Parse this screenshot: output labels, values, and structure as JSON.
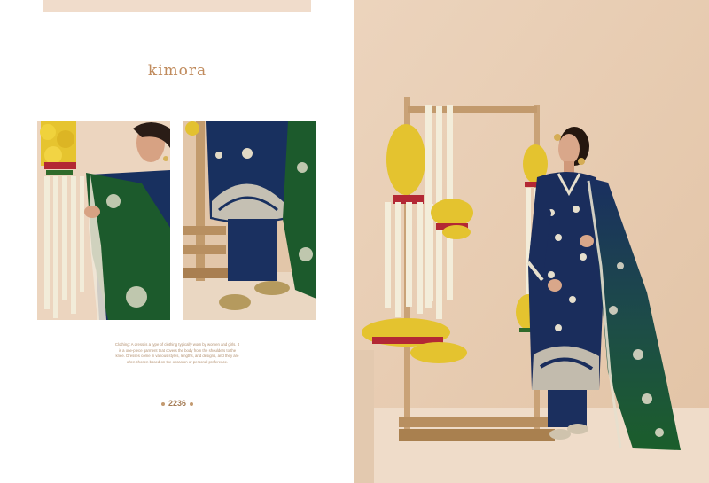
{
  "brand": "kimora",
  "description": "Clothing: A dress is a type of clothing typically worn by women and girls. It is a one-piece garment that covers the body from the shoulders to the knee. Dresses come in various styles, lengths, and designs, and they are often chosen based on the occasion or personal preference.",
  "catalog_code": "2236",
  "colors": {
    "background_left": "#ffffff",
    "background_right": "#e8cdb4",
    "brand_color": "#c08b5d",
    "navy_suit": "#18305f",
    "green_dupatta": "#1a5a2a",
    "marigold": "#e8c22e",
    "wood": "#c9a57a"
  },
  "images": [
    {
      "name": "detail-photo-dupatta",
      "subject": "model in navy suit with green dupatta beside marigold garland"
    },
    {
      "name": "detail-photo-hem",
      "subject": "embroidered navy kurta hem with trousers and juttis"
    },
    {
      "name": "hero-photo",
      "subject": "model standing in navy embroidered suit with green dupatta beside wooden rack with flower garlands"
    }
  ]
}
